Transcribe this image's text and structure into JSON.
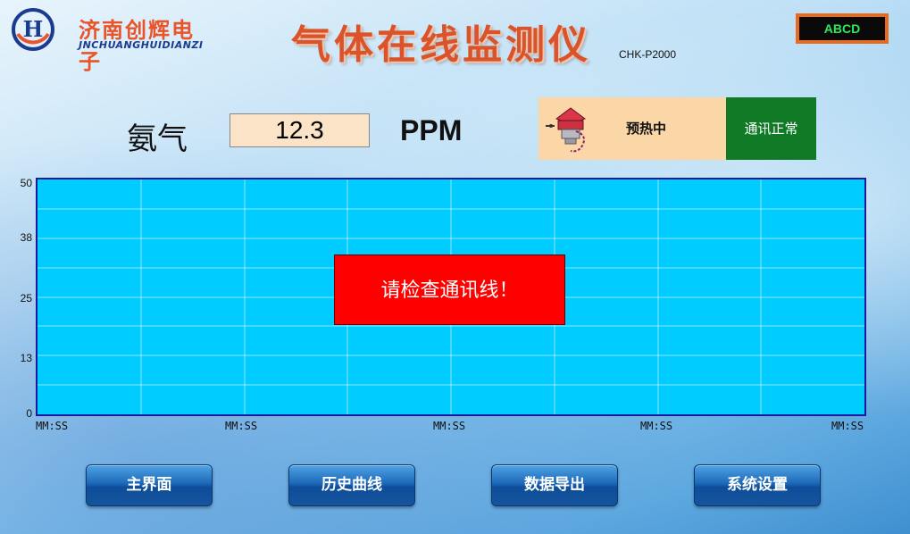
{
  "header": {
    "company_cn": "济南创辉电子",
    "company_en": "JNCHUANGHUIDIANZI",
    "title": "气体在线监测仪",
    "model": "CHK-P2000",
    "indicator": "ABCD"
  },
  "reading": {
    "gas": "氨气",
    "value": "12.3",
    "unit": "PPM"
  },
  "status": {
    "sensor": "预热中",
    "comm": "通讯正常"
  },
  "colors": {
    "accent_title": "#d9532b",
    "plot_bg": "#00ccff",
    "alert_bg": "#ff0000",
    "comm_ok": "#117a27",
    "indicator_text": "#2fe85a"
  },
  "alert": "请检查通讯线！",
  "chart_data": {
    "type": "line",
    "ylim": [
      0,
      50
    ],
    "yticks": [
      "50",
      "38",
      "25",
      "13",
      "0"
    ],
    "xticks": [
      "MM:SS",
      "MM:SS",
      "MM:SS",
      "MM:SS",
      "MM:SS"
    ],
    "grid": true,
    "series": []
  },
  "buttons": [
    "主界面",
    "历史曲线",
    "数据导出",
    "系统设置"
  ],
  "icons": {
    "logo": "h-logo-icon",
    "sensor": "gas-sensor-icon"
  }
}
